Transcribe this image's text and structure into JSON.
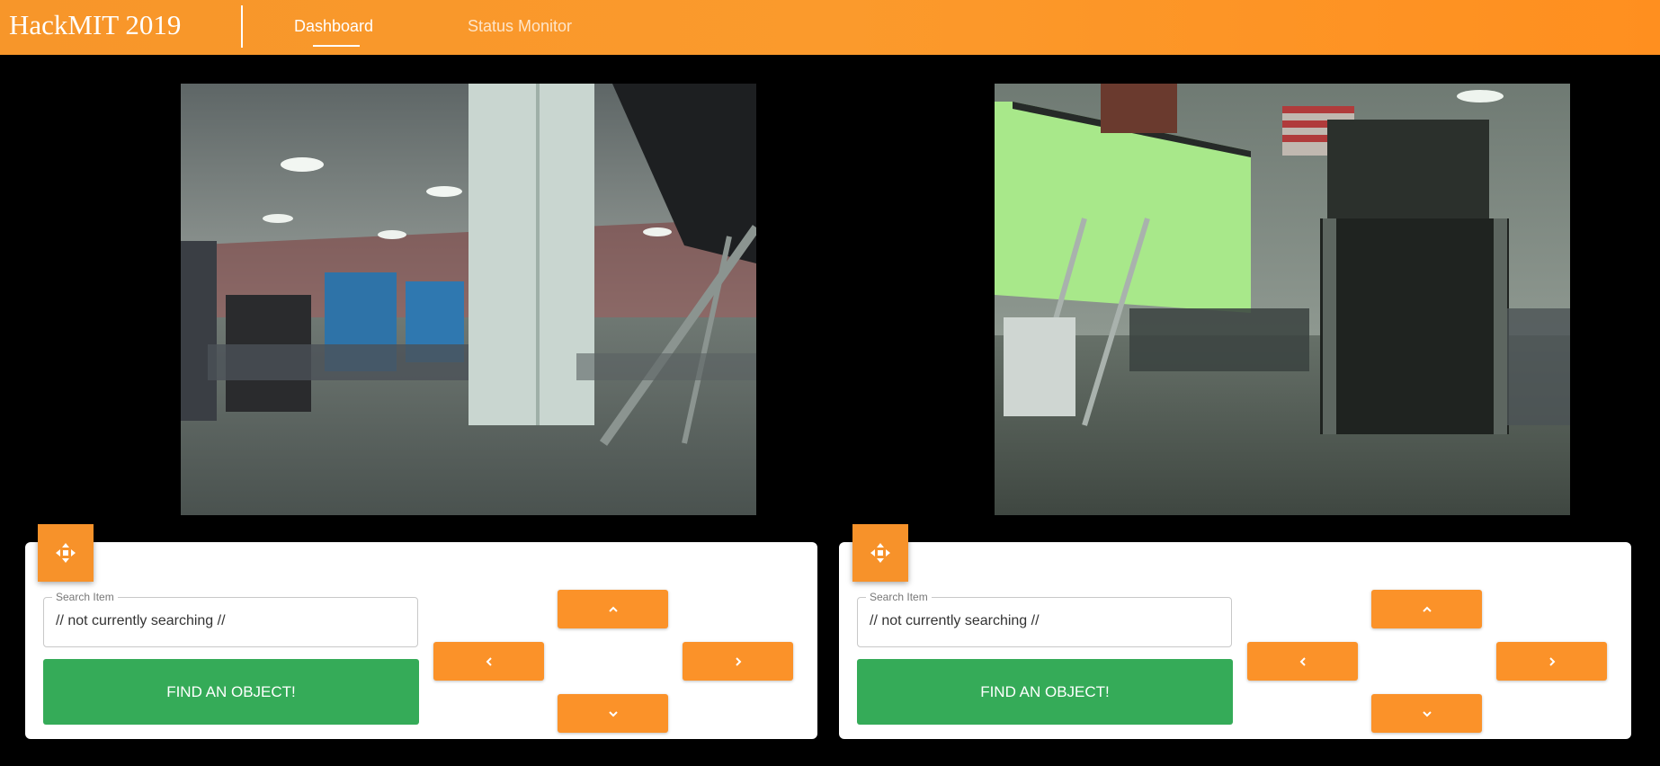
{
  "app": {
    "title": "HackMIT 2019",
    "nav": [
      {
        "label": "Dashboard",
        "active": true
      },
      {
        "label": "Status Monitor",
        "active": false
      }
    ]
  },
  "colors": {
    "header_orange": "#f7962a",
    "button_orange": "#fb9229",
    "find_green": "#35ab58"
  },
  "robots": [
    {
      "camera_feed": {
        "icon": "camera-feed-image"
      },
      "drag_icon": "move-arrows-icon",
      "search": {
        "label": "Search Item",
        "value": "// not currently searching //"
      },
      "find_button": "FIND AN OBJECT!",
      "controls": [
        "chevron-up-icon",
        "chevron-left-icon",
        "chevron-right-icon",
        "chevron-down-icon"
      ]
    },
    {
      "camera_feed": {
        "icon": "camera-feed-image"
      },
      "drag_icon": "move-arrows-icon",
      "search": {
        "label": "Search Item",
        "value": "// not currently searching //"
      },
      "find_button": "FIND AN OBJECT!",
      "controls": [
        "chevron-up-icon",
        "chevron-left-icon",
        "chevron-right-icon",
        "chevron-down-icon"
      ]
    }
  ]
}
